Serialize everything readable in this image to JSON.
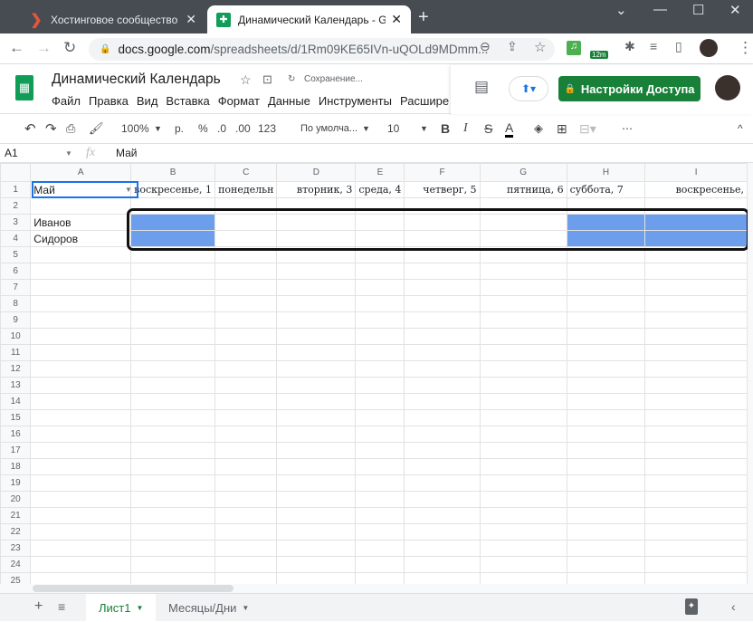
{
  "browser": {
    "tabs": [
      {
        "title": "Хостинговое сообщество «Time",
        "icon": "timeweb-chevron-icon"
      },
      {
        "title": "Динамический Календарь - Goo",
        "icon": "sheets-icon",
        "active": true
      }
    ],
    "url_host": "docs.google.com",
    "url_path": "/spreadsheets/d/1Rm09KE65IVn-uQOLd9MDmm...",
    "ext_badge": "12m"
  },
  "doc": {
    "title": "Динамический Календарь",
    "save_status": "Сохранение...",
    "share_label": "Настройки Доступа",
    "menu": [
      "Файл",
      "Правка",
      "Вид",
      "Вставка",
      "Формат",
      "Данные",
      "Инструменты",
      "Расшире"
    ]
  },
  "toolbar": {
    "zoom": "100%",
    "currency": "р.",
    "percent": "%",
    "dec_less": ".0",
    "dec_more": ".00",
    "format": "123",
    "font": "По умолча...",
    "size": "10",
    "bold": "B",
    "italic": "I",
    "strike": "S",
    "color": "A",
    "more": "⋯"
  },
  "formula": {
    "cell_ref": "A1",
    "fx": "fx",
    "value": "Май"
  },
  "grid": {
    "columns": [
      "A",
      "B",
      "C",
      "D",
      "E",
      "F",
      "G",
      "H",
      "I"
    ],
    "rows": [
      [
        "Май",
        "воскресенье, 1",
        "понедельн",
        "вторник, 3",
        "среда, 4",
        "четверг, 5",
        "пятница, 6",
        "суббота, 7",
        "воскресенье,"
      ],
      [
        "",
        "",
        "",
        "",
        "",
        "",
        "",
        "",
        ""
      ],
      [
        "Иванов",
        "",
        "",
        "",
        "",
        "",
        "",
        "",
        ""
      ],
      [
        "Сидоров",
        "",
        "",
        "",
        "",
        "",
        "",
        "",
        ""
      ]
    ],
    "total_rows": 25,
    "highlight_color": "#6d9eeb"
  },
  "sheets": {
    "tabs": [
      "Лист1",
      "Месяцы/Дни"
    ],
    "active": "Лист1"
  }
}
